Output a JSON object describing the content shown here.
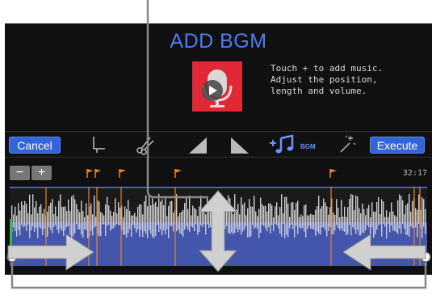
{
  "screen": {
    "title": "ADD BGM",
    "hint": "Touch + to add music.\nAdjust the position,\nlength and volume.",
    "timecode": "32:17"
  },
  "toolbar": {
    "cancel_label": "Cancel",
    "execute_label": "Execute",
    "bgm_label": "BGM",
    "tools": [
      "trim-icon",
      "scissors-icon",
      "fade-in-icon",
      "fade-out-icon",
      "add-music-icon",
      "magic-wand-icon"
    ]
  },
  "zoom": {
    "minus": "−",
    "plus": "+"
  },
  "colors": {
    "accent": "#3465d8",
    "title": "#4f7cf0",
    "marker": "#e8822a",
    "bgm_bar": "#4a5fc0",
    "mic_bg": "#e02836"
  }
}
